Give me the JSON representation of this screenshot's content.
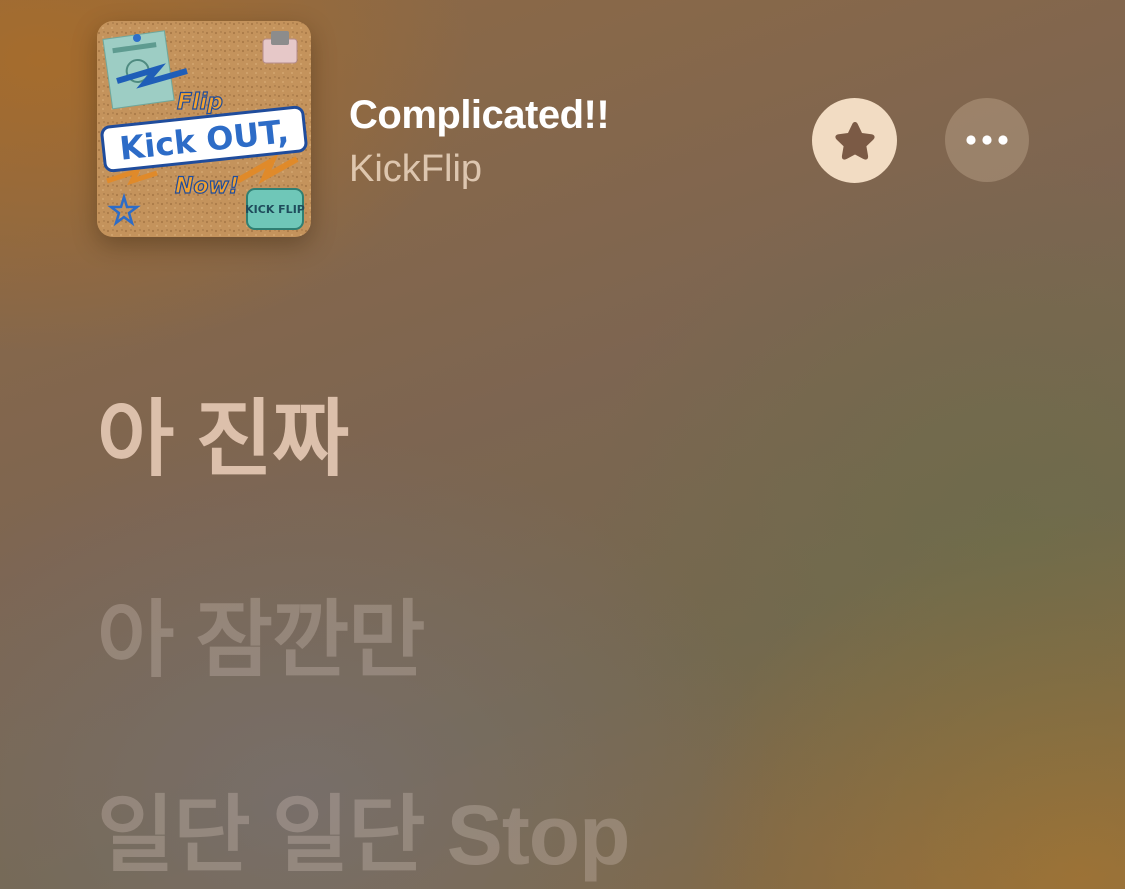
{
  "now_playing": {
    "title": "Complicated!!",
    "artist": "KickFlip",
    "artwork": {
      "icon": "album-art",
      "text_main": "Kick OUT,",
      "text_top": "Flip",
      "text_bottom": "Now!",
      "badge": "KICK FLIP"
    }
  },
  "actions": {
    "favorite_icon": "star-icon",
    "more_icon": "ellipsis-icon"
  },
  "lyrics": {
    "lines": [
      "아 진짜",
      "아 잠깐만",
      "일단 일단 Stop"
    ],
    "active_index": 0
  },
  "colors": {
    "favorite_bg": "#f2dcc3",
    "favorite_icon": "#7b5a45",
    "active_lyric": "#f0d4c0"
  }
}
